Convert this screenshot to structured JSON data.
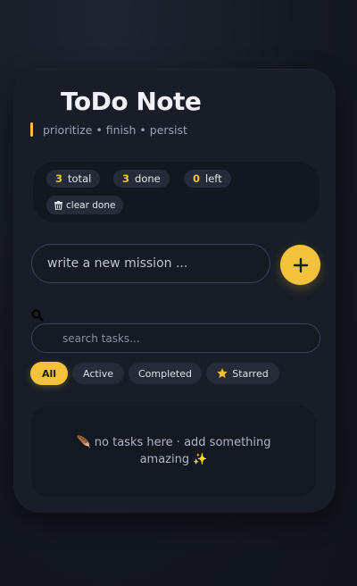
{
  "app": {
    "title": "ToDo Note",
    "subtitle": "prioritize • finish • persist"
  },
  "stats": {
    "total_count": "3",
    "total_label": "total",
    "done_count": "3",
    "done_label": "done",
    "left_count": "0",
    "left_label": "left",
    "clear_label": "clear done"
  },
  "add_task": {
    "placeholder": "write a new mission ...",
    "button_symbol": "+"
  },
  "search": {
    "placeholder": "search tasks..."
  },
  "filters": [
    {
      "label": "All",
      "active": true
    },
    {
      "label": "Active",
      "active": false
    },
    {
      "label": "Completed",
      "active": false
    },
    {
      "label": "Starred",
      "active": false
    }
  ],
  "empty_state": {
    "message": "🪶 no tasks here · add something amazing ✨"
  },
  "colors": {
    "accent": "#f2c23d",
    "background": "#141820",
    "card": "#181d27"
  }
}
